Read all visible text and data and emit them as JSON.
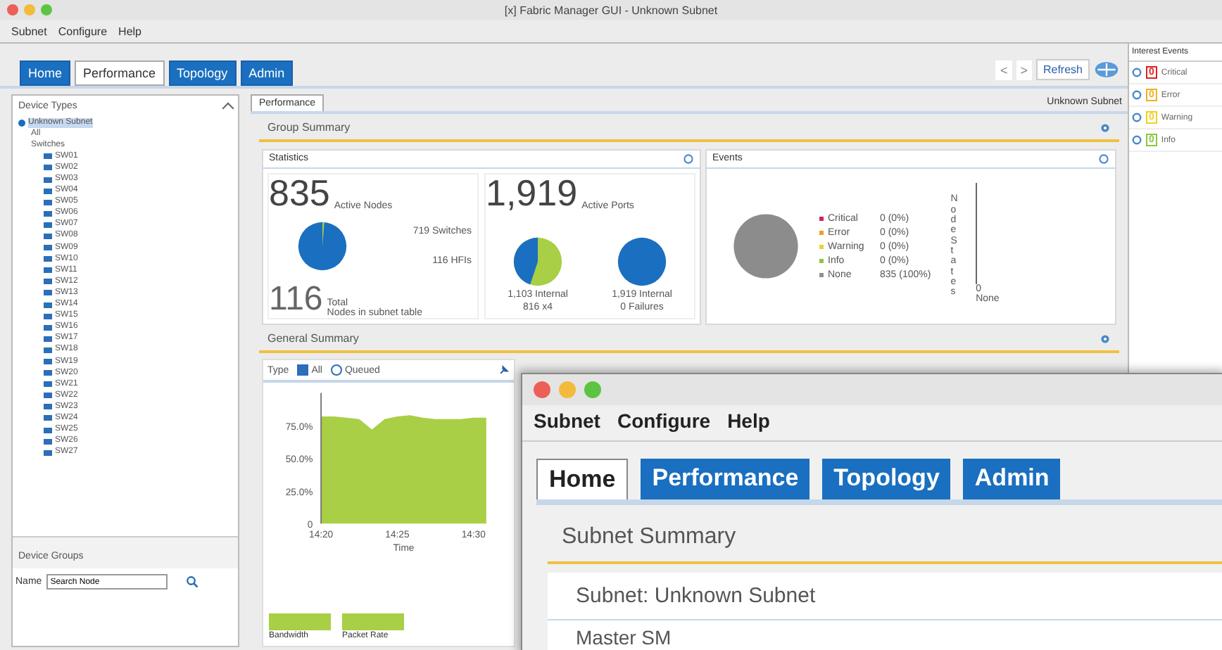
{
  "window": {
    "title": "[x] Fabric Manager GUI - Unknown Subnet"
  },
  "menu": [
    "Subnet",
    "Configure",
    "Help"
  ],
  "tabs": [
    {
      "label": "Home",
      "selected": false
    },
    {
      "label": "Performance",
      "selected": true
    },
    {
      "label": "Topology",
      "selected": false
    },
    {
      "label": "Admin",
      "selected": false
    }
  ],
  "toolbar": {
    "back": "<",
    "forward": ">",
    "refresh": "Refresh"
  },
  "events_panel": {
    "title": "Interest Events",
    "items": [
      {
        "count": "0",
        "label": "Critical",
        "color": "#e02020"
      },
      {
        "count": "0",
        "label": "Error",
        "color": "#f0b020"
      },
      {
        "count": "0",
        "label": "Warning",
        "color": "#f0d020"
      },
      {
        "count": "0",
        "label": "Info",
        "color": "#8cc63f"
      }
    ]
  },
  "sidebar": {
    "title": "Device Types",
    "tree": [
      {
        "label": "Unknown Subnet",
        "selected": true,
        "children": [
          {
            "label": "All",
            "selected": false
          },
          {
            "label": "Switches",
            "selected": false,
            "children": [
              {
                "label": "SW01",
                "selected": false
              },
              {
                "label": "SW02",
                "selected": false
              },
              {
                "label": "SW03",
                "selected": false
              },
              {
                "label": "SW04",
                "selected": false
              },
              {
                "label": "SW05",
                "selected": false
              },
              {
                "label": "SW06",
                "selected": false
              },
              {
                "label": "SW07",
                "selected": false
              },
              {
                "label": "SW08",
                "selected": false
              },
              {
                "label": "SW09",
                "selected": false
              },
              {
                "label": "SW10",
                "selected": false
              },
              {
                "label": "SW11",
                "selected": false
              },
              {
                "label": "SW12",
                "selected": false
              },
              {
                "label": "SW13",
                "selected": false
              },
              {
                "label": "SW14",
                "selected": false
              },
              {
                "label": "SW15",
                "selected": false
              },
              {
                "label": "SW16",
                "selected": false
              },
              {
                "label": "SW17",
                "selected": false
              },
              {
                "label": "SW18",
                "selected": false
              },
              {
                "label": "SW19",
                "selected": false
              },
              {
                "label": "SW20",
                "selected": false
              },
              {
                "label": "SW21",
                "selected": false
              },
              {
                "label": "SW22",
                "selected": false
              },
              {
                "label": "SW23",
                "selected": false
              },
              {
                "label": "SW24",
                "selected": false
              },
              {
                "label": "SW25",
                "selected": false
              },
              {
                "label": "SW26",
                "selected": false
              },
              {
                "label": "SW27",
                "selected": false
              }
            ]
          }
        ]
      }
    ],
    "groups_title": "Device Groups",
    "search_label": "Name",
    "search_value": "Search Node"
  },
  "subtab": {
    "label": "Performance",
    "selected": true
  },
  "context": "Unknown Subnet",
  "group_summary": {
    "title": "Group Summary",
    "statistics": {
      "title": "Statistics",
      "nodes": "835",
      "nodes_label": "Active Nodes",
      "switches": "719 Switches",
      "hfis": "116 HFIs",
      "fabric": "116",
      "fabric_label": "Total",
      "fabric_sub": "Nodes in subnet table",
      "ports": "1,919",
      "ports_label": "Active Ports",
      "internal": "1,103 Internal",
      "internal_sub": "816 x4",
      "external": "1,919 Internal",
      "external_sub": "0 Failures"
    },
    "events": {
      "title": "Events",
      "legend": [
        {
          "label": "Critical",
          "value": "0 (0%)",
          "color": "#d0206a"
        },
        {
          "label": "Error",
          "value": "0 (0%)",
          "color": "#f0a020"
        },
        {
          "label": "Warning",
          "value": "0 (0%)",
          "color": "#f0d030"
        },
        {
          "label": "Info",
          "value": "0 (0%)",
          "color": "#8cc63f"
        },
        {
          "label": "None",
          "value": "835 (100%)",
          "color": "#909090"
        }
      ],
      "axis_label": "Node States",
      "axis_zero": "0",
      "axis_caption": "None"
    }
  },
  "general_summary": {
    "title": "General Summary",
    "filters": [
      {
        "label": "Type",
        "kind": "text"
      },
      {
        "label": "All",
        "kind": "check",
        "checked": true
      },
      {
        "label": "Queued",
        "kind": "radio",
        "checked": false
      }
    ],
    "chart_data": {
      "type": "area",
      "xlabel": "Time",
      "x": [
        "14:20",
        null,
        null,
        null,
        null,
        null,
        "14:25",
        null,
        null,
        null,
        null,
        null,
        "14:30",
        null
      ],
      "series": [
        {
          "color": "#a8cf45",
          "values": [
            82,
            82,
            81,
            80,
            72,
            80,
            82,
            83,
            81,
            80,
            80,
            80,
            81,
            81
          ]
        }
      ],
      "ylim": [
        0,
        100
      ],
      "yticks": [
        {
          "value": 0,
          "label": "0"
        },
        {
          "value": 25,
          "label": "25.0%"
        },
        {
          "value": 50,
          "label": "50.0%"
        },
        {
          "value": 75,
          "label": "75.0%"
        }
      ]
    },
    "legend": [
      {
        "label": "Bandwidth",
        "color": "#a8cf45"
      },
      {
        "label": "Packet Rate",
        "color": "#a8cf45"
      }
    ]
  },
  "inset": {
    "menu": [
      "Subnet",
      "Configure",
      "Help"
    ],
    "tabs": [
      {
        "label": "Home",
        "selected": true
      },
      {
        "label": "Performance",
        "selected": false
      },
      {
        "label": "Topology",
        "selected": false
      },
      {
        "label": "Admin",
        "selected": false
      }
    ],
    "section": "Subnet Summary",
    "subnet": "Subnet: Unknown Subnet",
    "row_label": "Master SM"
  }
}
